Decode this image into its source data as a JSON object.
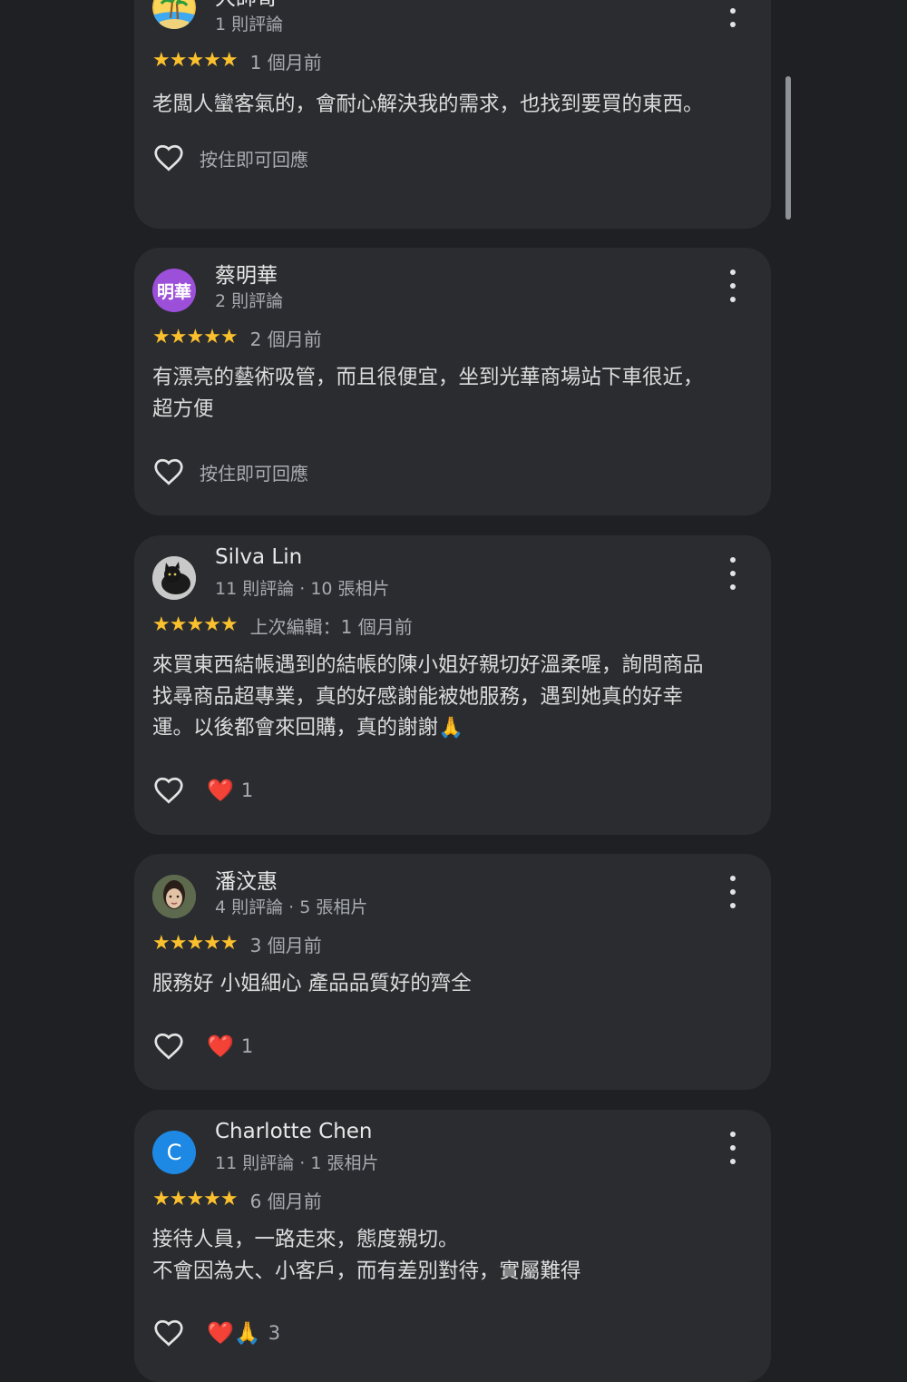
{
  "colors": {
    "background": "#1e2023",
    "card": "#2a2c30",
    "star": "#fbc02d",
    "secondary_text": "#a8abb0",
    "avatar_purple": "#9c4fd9",
    "avatar_blue": "#1e88e5"
  },
  "reviews": [
    {
      "name": "大帥哥",
      "meta": "1 則評論",
      "avatar": {
        "type": "image",
        "icon": "palm-island-icon"
      },
      "stars": "★★★★★",
      "rating": 5,
      "time": "1 個月前",
      "text": "老闆人蠻客氣的，會耐心解決我的需求，也找到要買的東西。",
      "hint": "按住即可回應"
    },
    {
      "name": "蔡明華",
      "meta": "2 則評論",
      "avatar": {
        "type": "text",
        "text": "明華",
        "color": "#9c4fd9"
      },
      "stars": "★★★★★",
      "rating": 5,
      "time": "2 個月前",
      "text": "有漂亮的藝術吸管，而且很便宜，坐到光華商場站下車很近，\n超方便",
      "hint": "按住即可回應"
    },
    {
      "name": "Silva Lin",
      "meta": "11 則評論 · 10 張相片",
      "avatar": {
        "type": "image",
        "icon": "black-cat-photo"
      },
      "stars": "★★★★★",
      "rating": 5,
      "time": "上次編輯：1 個月前",
      "text": "來買東西結帳遇到的結帳的陳小姐好親切好溫柔喔，詢問商品\n找尋商品超專業，真的好感謝能被她服務，遇到她真的好幸\n運。以後都會來回購，真的謝謝🙏",
      "reaction_emoji": "❤️",
      "reaction_count": "1"
    },
    {
      "name": "潘汶惠",
      "meta": "4 則評論 · 5 張相片",
      "avatar": {
        "type": "image",
        "icon": "portrait-photo"
      },
      "stars": "★★★★★",
      "rating": 5,
      "time": "3 個月前",
      "text": "服務好 小姐細心 產品品質好的齊全",
      "reaction_emoji": "❤️",
      "reaction_count": "1"
    },
    {
      "name": "Charlotte Chen",
      "meta": "11 則評論 · 1 張相片",
      "avatar": {
        "type": "letter",
        "text": "C",
        "color": "#1e88e5"
      },
      "stars": "★★★★★",
      "rating": 5,
      "time": "6 個月前",
      "text": "接待人員，一路走來，態度親切。\n不會因為大、小客戶，而有差別對待，實屬難得",
      "reaction_emoji": "❤️🙏",
      "reaction_count": "3"
    }
  ]
}
